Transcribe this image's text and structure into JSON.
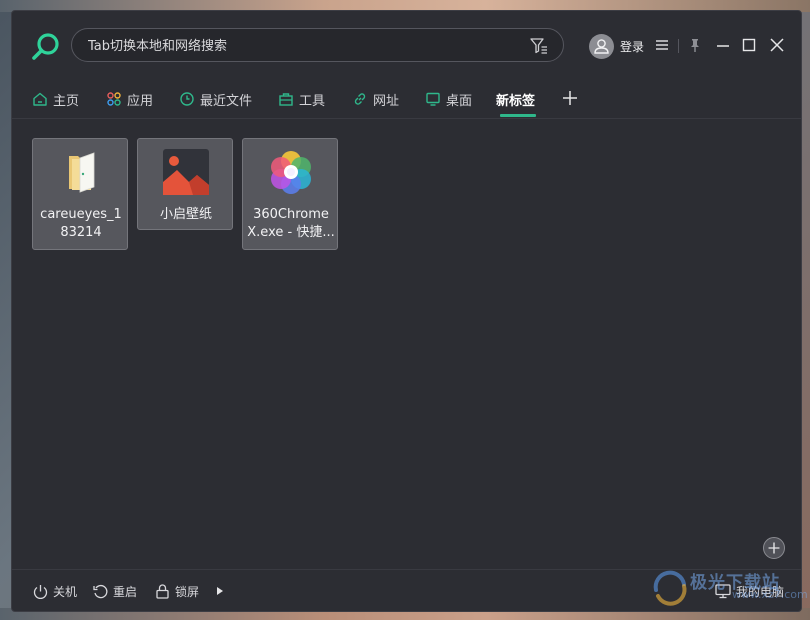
{
  "search": {
    "placeholder": "Tab切换本地和网络搜索"
  },
  "header": {
    "login_label": "登录"
  },
  "tabs": [
    {
      "label": "主页",
      "icon": "home-icon"
    },
    {
      "label": "应用",
      "icon": "apps-icon"
    },
    {
      "label": "最近文件",
      "icon": "clock-icon"
    },
    {
      "label": "工具",
      "icon": "toolbox-icon"
    },
    {
      "label": "网址",
      "icon": "link-icon"
    },
    {
      "label": "桌面",
      "icon": "monitor-icon"
    },
    {
      "label": "新标签",
      "icon": "",
      "active": true
    }
  ],
  "tiles": [
    {
      "name": "careueyes_183214",
      "icon": "folder-icon"
    },
    {
      "name": "小启壁纸",
      "icon": "picture-icon"
    },
    {
      "name": "360ChromeX.exe - 快捷...",
      "icon": "chrome-360-icon"
    }
  ],
  "footer": {
    "shutdown": "关机",
    "restart": "重启",
    "lock": "锁屏",
    "my_computer": "我的电脑"
  },
  "watermark": {
    "text": "极光下载站",
    "sub": "www.xz7.com"
  },
  "colors": {
    "accent": "#2fb78b",
    "window_bg": "#2c2d33",
    "tile_bg": "#56575d"
  }
}
